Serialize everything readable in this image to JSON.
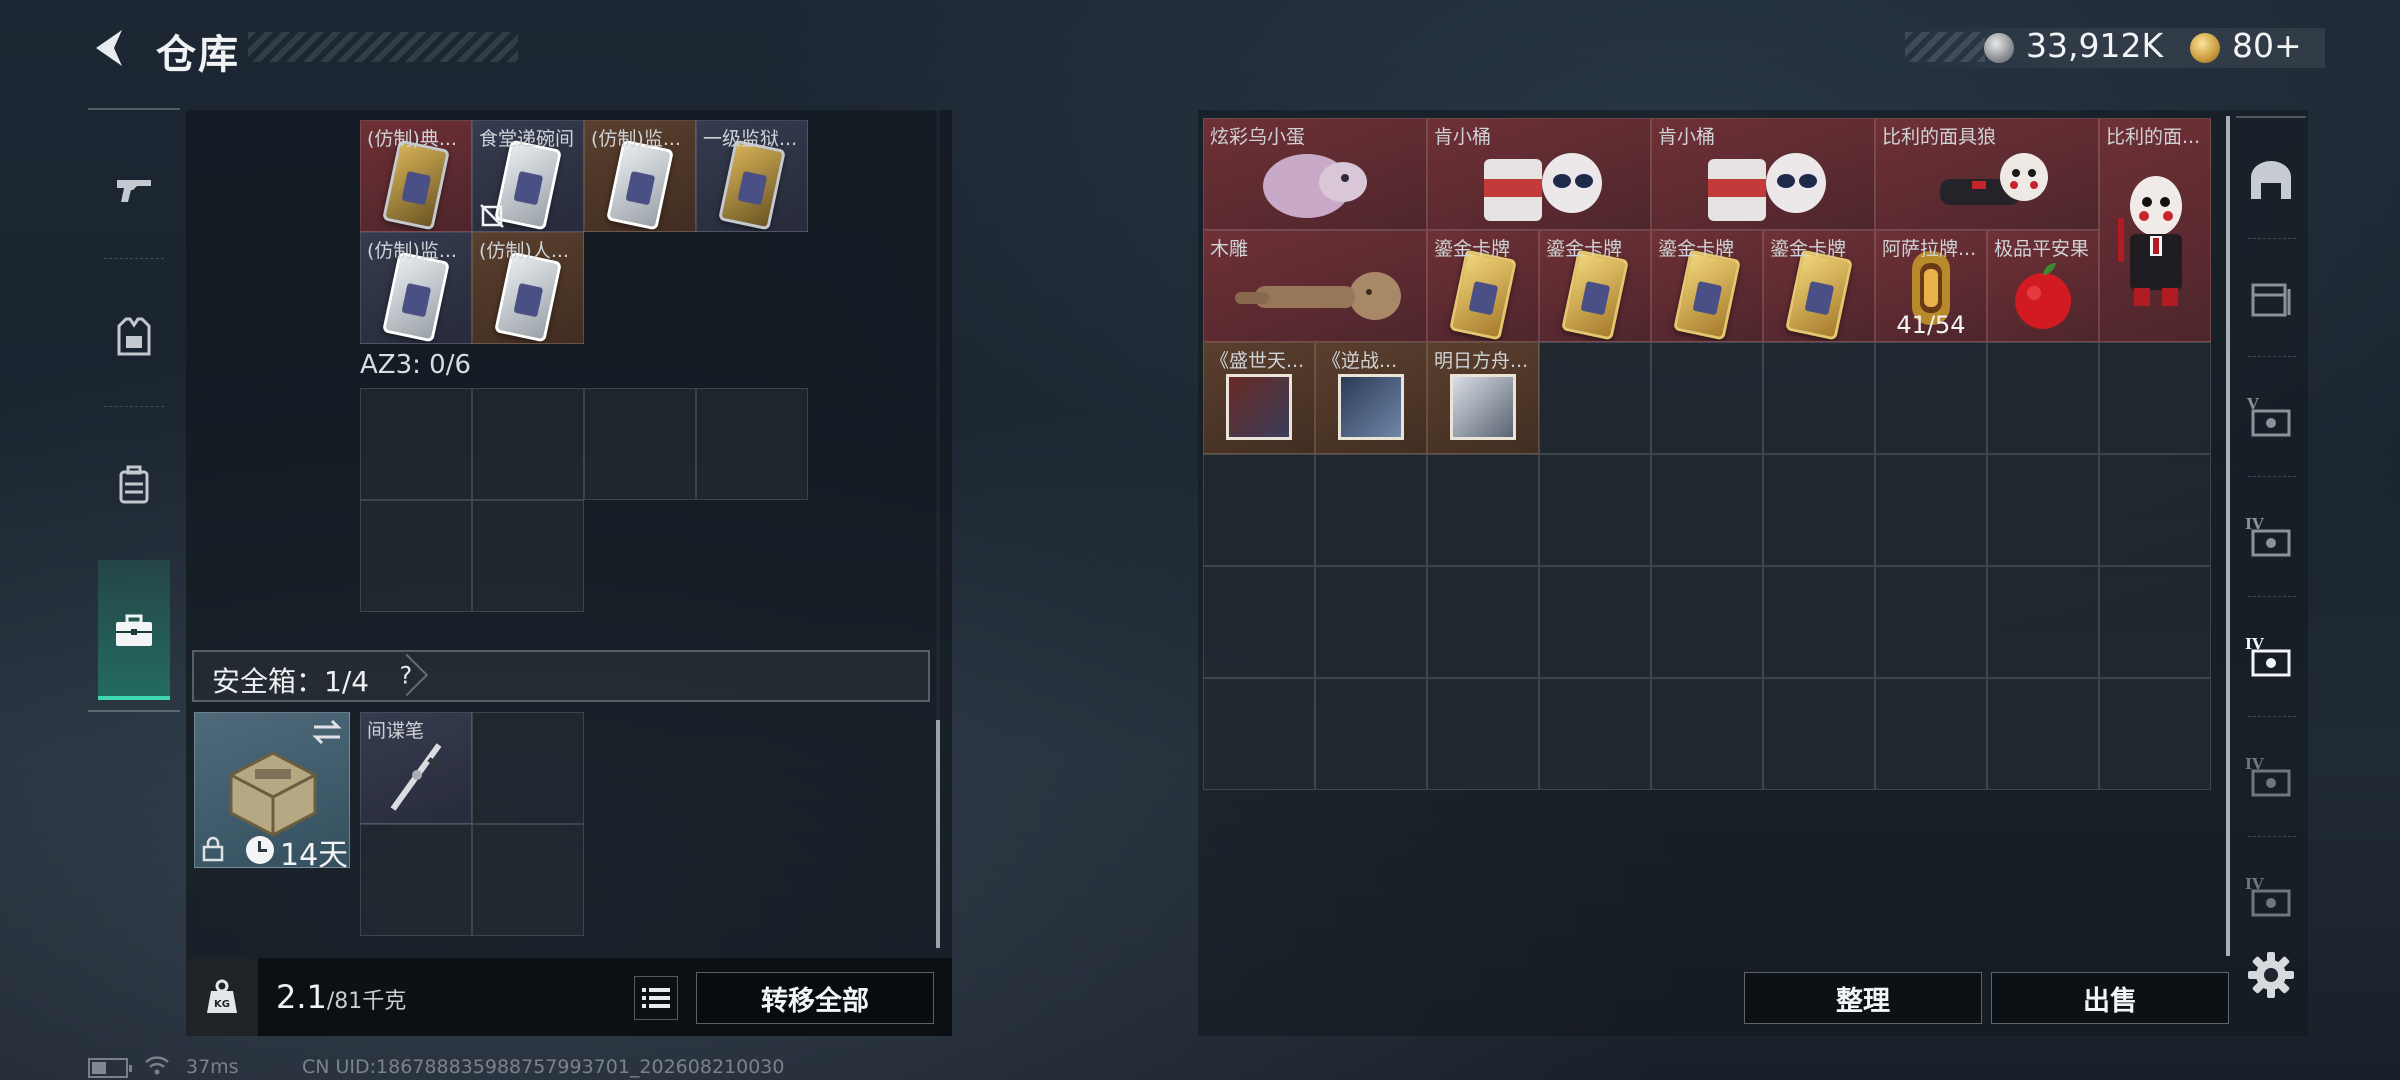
{
  "header": {
    "title": "仓库",
    "currencies": [
      {
        "name": "silver-coin",
        "value": "33,912K"
      },
      {
        "name": "gold-coin",
        "value": "80+"
      }
    ]
  },
  "nav": {
    "items": [
      {
        "name": "weapon",
        "icon": "pistol-icon",
        "active": false
      },
      {
        "name": "armor",
        "icon": "vest-icon",
        "active": false
      },
      {
        "name": "backpack",
        "icon": "backpack-icon",
        "active": false
      },
      {
        "name": "case",
        "icon": "briefcase-icon",
        "active": true
      }
    ]
  },
  "left": {
    "container_items": [
      {
        "label": "(仿制)典...",
        "color": "red",
        "art": "gold-card"
      },
      {
        "label": "食堂递碗间",
        "color": "blue",
        "art": "card",
        "badge": "no-transfer-icon"
      },
      {
        "label": "(仿制)监...",
        "color": "brown",
        "art": "card"
      },
      {
        "label": "一级监狱...",
        "color": "blue",
        "art": "gold-card"
      },
      {
        "label": "(仿制)监...",
        "color": "blue",
        "art": "card"
      },
      {
        "label": "(仿制)人...",
        "color": "brown",
        "art": "card"
      }
    ],
    "az3_label": "AZ3: 0/6",
    "safe_box": {
      "label": "安全箱：1/4",
      "help": "?",
      "days": "14天",
      "items": [
        {
          "label": "间谍笔",
          "art": "pen"
        }
      ]
    },
    "weight": {
      "current": "2.1",
      "capacity": "/81千克",
      "icon_text": "KG"
    },
    "transfer_all": "转移全部"
  },
  "right": {
    "row1": [
      {
        "label": "炫彩乌小蛋",
        "art": "egg-plush",
        "span": 2
      },
      {
        "label": "肯小桶",
        "art": "bucket-plush",
        "span": 2
      },
      {
        "label": "肯小桶",
        "art": "bucket-plush",
        "span": 2
      },
      {
        "label": "比利的面具狼",
        "art": "billy-plush",
        "span": 2
      },
      {
        "label": "比利的面...",
        "art": "billy-figure",
        "span": 1
      }
    ],
    "row2": [
      {
        "label": "木雕",
        "art": "wood-carving",
        "span": 2
      },
      {
        "label": "鎏金卡牌",
        "art": "gilded-card",
        "span": 1
      },
      {
        "label": "鎏金卡牌",
        "art": "gilded-card",
        "span": 1
      },
      {
        "label": "鎏金卡牌",
        "art": "gilded-card",
        "span": 1
      },
      {
        "label": "鎏金卡牌",
        "art": "gilded-card",
        "span": 1
      },
      {
        "label": "阿萨拉牌...",
        "art": "lamp",
        "span": 1,
        "count": "41/54"
      },
      {
        "label": "极品平安果",
        "art": "apple",
        "span": 1
      }
    ],
    "row3": [
      {
        "label": "《盛世天...",
        "art": "album"
      },
      {
        "label": "《逆战...",
        "art": "album"
      },
      {
        "label": "明日方舟...",
        "art": "album"
      }
    ],
    "sort_btn": "整理",
    "sell_btn": "出售"
  },
  "rail": {
    "items": [
      "bunker-icon",
      "crate-icon",
      "level5-case-icon",
      "level4-case-icon",
      "level4-active-case-icon",
      "level4-case-icon-b",
      "level4-case-icon-c"
    ]
  },
  "footer": {
    "ping": "37ms",
    "uid": "CN UID:1867888359887579937​01_202608210030",
    "battery_level": 0.4
  },
  "colors": {
    "accent": "#3fd7b0",
    "item_red": "#6e3038",
    "panel": "#12181e"
  }
}
